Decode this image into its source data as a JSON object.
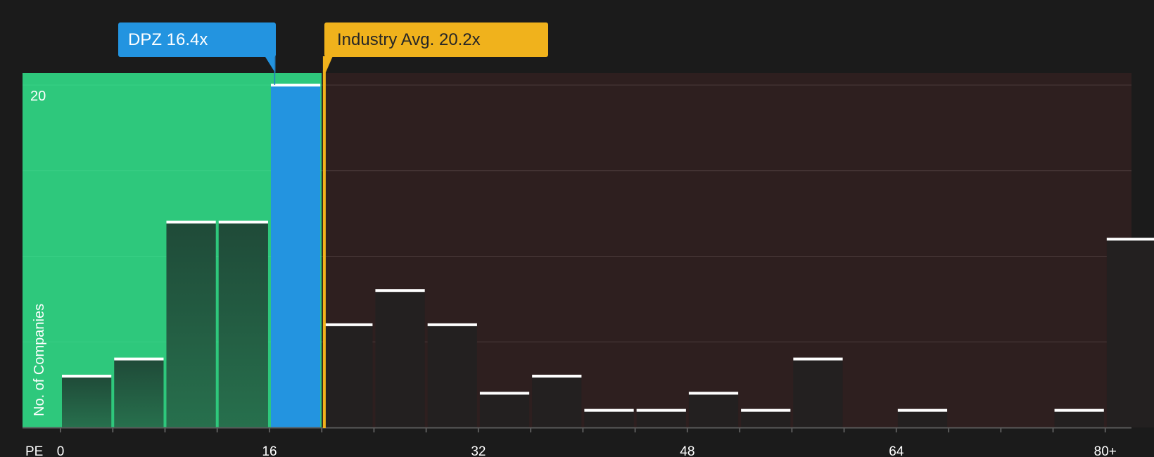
{
  "chart_data": {
    "type": "bar",
    "xlabel": "PE",
    "ylabel": "No. of Companies",
    "ylim": [
      0,
      20.6
    ],
    "xlim": [
      -3,
      85.5
    ],
    "y_ticks": [
      {
        "value": 20,
        "label": "20"
      },
      {
        "value": 15,
        "label": ""
      },
      {
        "value": 10,
        "label": ""
      },
      {
        "value": 5,
        "label": ""
      }
    ],
    "x_ticks": [
      {
        "value": 0,
        "label": "0"
      },
      {
        "value": 16,
        "label": "16"
      },
      {
        "value": 32,
        "label": "32"
      },
      {
        "value": 48,
        "label": "48"
      },
      {
        "value": 64,
        "label": "64"
      },
      {
        "value": 80,
        "label": "80+"
      }
    ],
    "bin_width": 4,
    "bins": [
      {
        "start": 0,
        "end": 4,
        "count": 3
      },
      {
        "start": 4,
        "end": 8,
        "count": 4
      },
      {
        "start": 8,
        "end": 12,
        "count": 12
      },
      {
        "start": 12,
        "end": 16,
        "count": 12
      },
      {
        "start": 16,
        "end": 20,
        "count": 20,
        "highlight": true
      },
      {
        "start": 20,
        "end": 24,
        "count": 6
      },
      {
        "start": 24,
        "end": 28,
        "count": 8
      },
      {
        "start": 28,
        "end": 32,
        "count": 6
      },
      {
        "start": 32,
        "end": 36,
        "count": 2
      },
      {
        "start": 36,
        "end": 40,
        "count": 3
      },
      {
        "start": 40,
        "end": 44,
        "count": 1
      },
      {
        "start": 44,
        "end": 48,
        "count": 1
      },
      {
        "start": 48,
        "end": 52,
        "count": 2
      },
      {
        "start": 52,
        "end": 56,
        "count": 1
      },
      {
        "start": 56,
        "end": 60,
        "count": 4
      },
      {
        "start": 60,
        "end": 64,
        "count": 0
      },
      {
        "start": 64,
        "end": 68,
        "count": 1
      },
      {
        "start": 68,
        "end": 72,
        "count": 0
      },
      {
        "start": 72,
        "end": 76,
        "count": 0
      },
      {
        "start": 76,
        "end": 80,
        "count": 1
      },
      {
        "start": 80,
        "end": 84,
        "count": 11
      }
    ],
    "company": {
      "ticker": "DPZ",
      "value": 16.4,
      "label": "DPZ 16.4x",
      "color": "#2394e0"
    },
    "industry_avg": {
      "value": 20.2,
      "label": "Industry Avg. 20.2x",
      "color": "#f0b21c"
    },
    "colors": {
      "undervalued_region": "#2ec87c",
      "overvalued_region": "#2e1f1f",
      "bar_fill": "#232020",
      "bar_cap": "#ffffff",
      "axis": "#5a5a5a",
      "text": "#ffffff"
    },
    "grid": true
  }
}
